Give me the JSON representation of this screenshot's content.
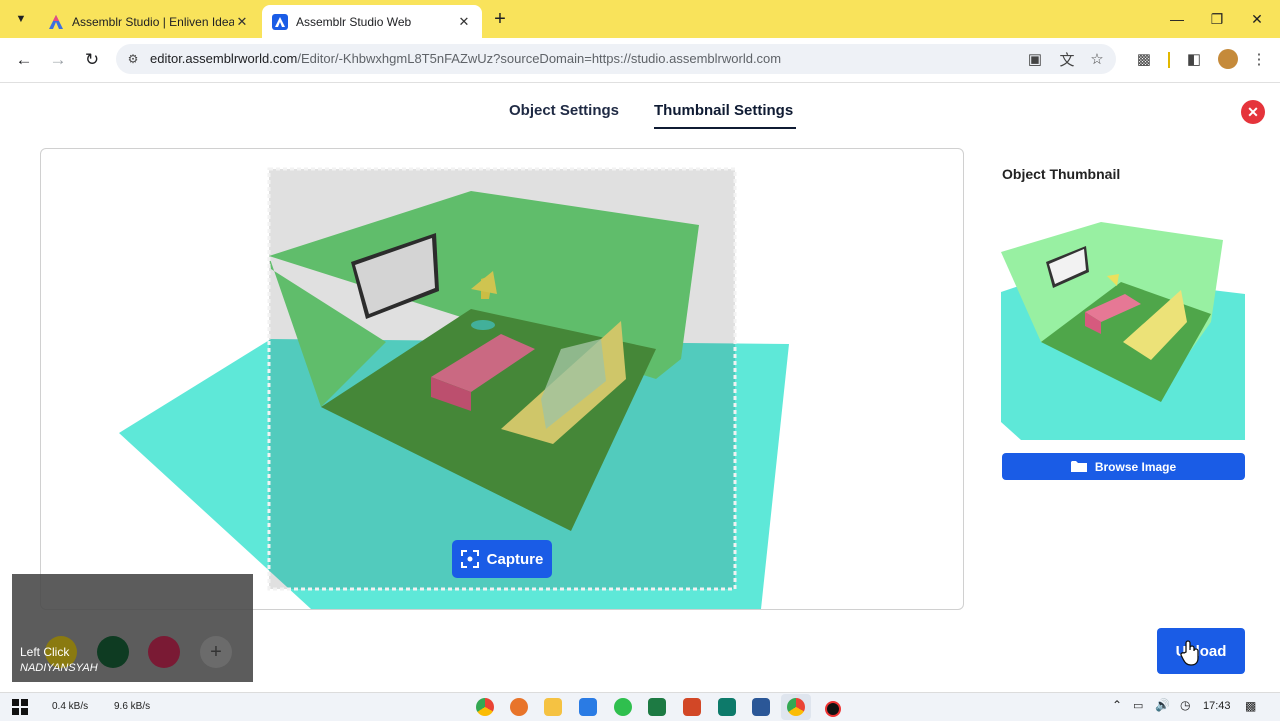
{
  "browser": {
    "tabs": [
      {
        "title": "Assemblr Studio | Enliven Ideas",
        "active": false
      },
      {
        "title": "Assemblr Studio Web",
        "active": true
      }
    ],
    "url_host": "editor.assemblrworld.com",
    "url_path": "/Editor/-KhbwxhgmL8T5nFAZwUz?sourceDomain=https://studio.assemblrworld.com",
    "colors": {
      "tabstrip": "#f9e35b"
    }
  },
  "app": {
    "tabs": {
      "object_settings": "Object Settings",
      "thumbnail_settings": "Thumbnail Settings"
    },
    "active_tab": "thumbnail_settings",
    "capture_label": "Capture",
    "thumbnail_title": "Object Thumbnail",
    "browse_label": "Browse Image",
    "upload_label": "Upload",
    "colors": {
      "primary": "#1a5ce6",
      "close": "#e5343b",
      "floor": "#5ee8d8",
      "walls": "#6ed87a"
    }
  },
  "overlay": {
    "click_text": "Left Click",
    "user": "NADIYANSYAH",
    "swatches": [
      "#8a7a10",
      "#0e3b22",
      "#7a1a34"
    ],
    "add_icon": "+"
  },
  "taskbar": {
    "net_up": "0.4 kB/s",
    "net_down": "9.6 kB/s",
    "time": "17:43"
  }
}
